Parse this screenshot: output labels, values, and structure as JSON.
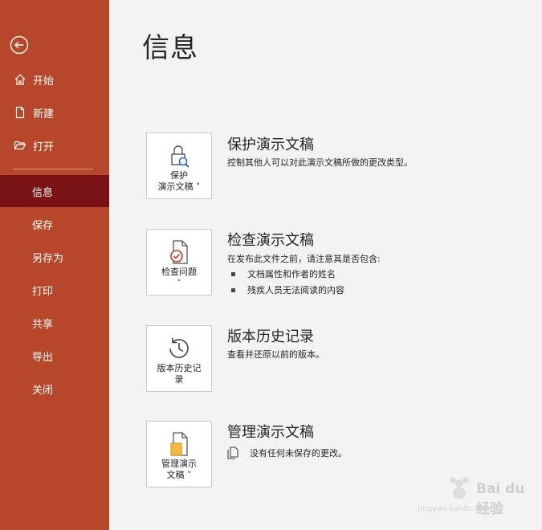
{
  "sidebar": {
    "items": [
      {
        "label": "开始"
      },
      {
        "label": "新建"
      },
      {
        "label": "打开"
      },
      {
        "label": "信息"
      },
      {
        "label": "保存"
      },
      {
        "label": "另存为"
      },
      {
        "label": "打印"
      },
      {
        "label": "共享"
      },
      {
        "label": "导出"
      },
      {
        "label": "关闭"
      }
    ]
  },
  "main": {
    "title": "信息",
    "sections": [
      {
        "button_label": "保护\n演示文稿 ˅",
        "title": "保护演示文稿",
        "description": "控制其他人可以对此演示文稿所做的更改类型。"
      },
      {
        "button_label": "检查问题\n˅",
        "title": "检查演示文稿",
        "description": "在发布此文件之前，请注意其是否包含:",
        "bullets": [
          "文档属性和作者的姓名",
          "残疾人员无法阅读的内容"
        ]
      },
      {
        "button_label": "版本历史记\n录",
        "title": "版本历史记录",
        "description": "查看并还原以前的版本。"
      },
      {
        "button_label": "管理演示\n文稿 ˅",
        "title": "管理演示文稿",
        "description": "没有任何未保存的更改。"
      }
    ]
  },
  "watermark": {
    "text": "Bai du 经验",
    "sub": "jingyan.baidu.com"
  },
  "colors": {
    "sidebar": "#b7472a",
    "active": "#7a1316",
    "background": "#f3f3f3"
  }
}
